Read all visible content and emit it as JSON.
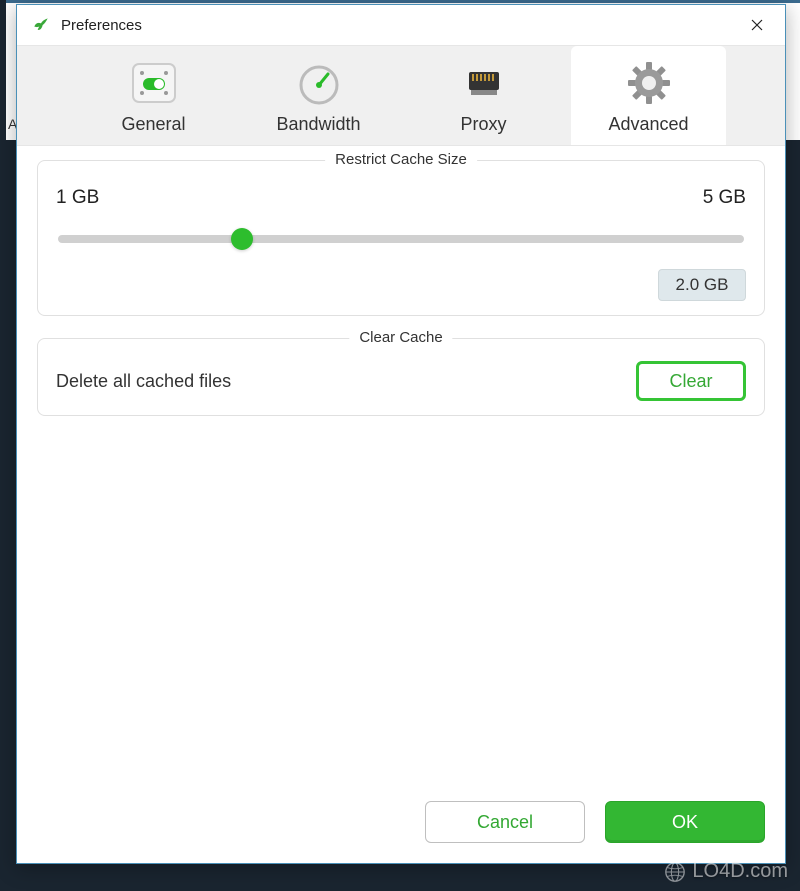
{
  "window": {
    "title": "Preferences"
  },
  "tabs": {
    "general": "General",
    "bandwidth": "Bandwidth",
    "proxy": "Proxy",
    "advanced": "Advanced",
    "active": "advanced"
  },
  "advanced": {
    "restrictCache": {
      "legend": "Restrict Cache Size",
      "minLabel": "1 GB",
      "maxLabel": "5 GB",
      "valueLabel": "2.0 GB",
      "percent": 27
    },
    "clearCache": {
      "legend": "Clear Cache",
      "description": "Delete all cached files",
      "buttonLabel": "Clear"
    }
  },
  "footer": {
    "cancel": "Cancel",
    "ok": "OK"
  },
  "watermark": "LO4D.com",
  "backdrop_letter": "A"
}
